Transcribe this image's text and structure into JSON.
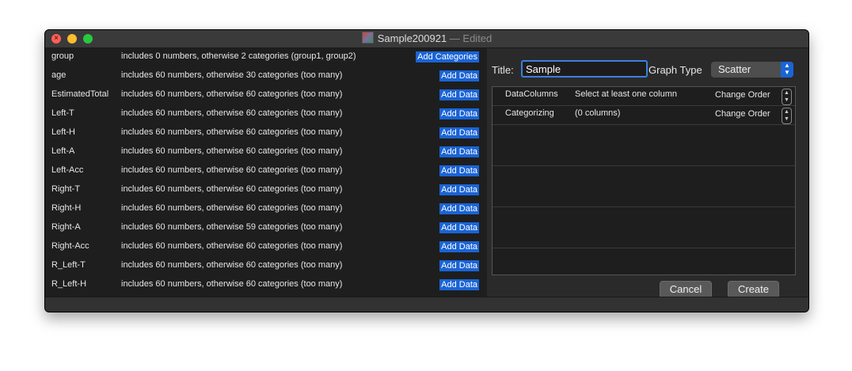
{
  "window": {
    "doc_title": "Sample200921",
    "edited_suffix": " — Edited"
  },
  "left_list": [
    {
      "name": "group",
      "desc": "includes 0 numbers, otherwise 2 categories (group1, group2)",
      "action": "Add Categories"
    },
    {
      "name": "age",
      "desc": "includes 60 numbers, otherwise 30 categories (too many)",
      "action": "Add Data"
    },
    {
      "name": "EstimatedTotal",
      "desc": "includes 60 numbers, otherwise 60 categories (too many)",
      "action": "Add Data"
    },
    {
      "name": "Left-T",
      "desc": "includes 60 numbers, otherwise 60 categories (too many)",
      "action": "Add Data"
    },
    {
      "name": "Left-H",
      "desc": "includes 60 numbers, otherwise 60 categories (too many)",
      "action": "Add Data"
    },
    {
      "name": "Left-A",
      "desc": "includes 60 numbers, otherwise 60 categories (too many)",
      "action": "Add Data"
    },
    {
      "name": "Left-Acc",
      "desc": "includes 60 numbers, otherwise 60 categories (too many)",
      "action": "Add Data"
    },
    {
      "name": "Right-T",
      "desc": "includes 60 numbers, otherwise 60 categories (too many)",
      "action": "Add Data"
    },
    {
      "name": "Right-H",
      "desc": "includes 60 numbers, otherwise 60 categories (too many)",
      "action": "Add Data"
    },
    {
      "name": "Right-A",
      "desc": "includes 60 numbers, otherwise 59 categories (too many)",
      "action": "Add Data"
    },
    {
      "name": "Right-Acc",
      "desc": "includes 60 numbers, otherwise 60 categories (too many)",
      "action": "Add Data"
    },
    {
      "name": "R_Left-T",
      "desc": "includes 60 numbers, otherwise 60 categories (too many)",
      "action": "Add Data"
    },
    {
      "name": "R_Left-H",
      "desc": "includes 60 numbers, otherwise 60 categories (too many)",
      "action": "Add Data"
    }
  ],
  "form": {
    "title_label": "Title:",
    "title_value": "Sample",
    "graph_type_label": "Graph Type",
    "graph_type_value": "Scatter"
  },
  "table": [
    {
      "name": "DataColumns",
      "value": "Select at least one column",
      "action": "Change Order"
    },
    {
      "name": "Categorizing",
      "value": "(0 columns)",
      "action": "Change Order"
    }
  ],
  "buttons": {
    "cancel": "Cancel",
    "create": "Create"
  },
  "colors": {
    "accent": "#1a64d6",
    "close": "#fe5f57",
    "minimize": "#febc2e",
    "maximize": "#28c840"
  }
}
